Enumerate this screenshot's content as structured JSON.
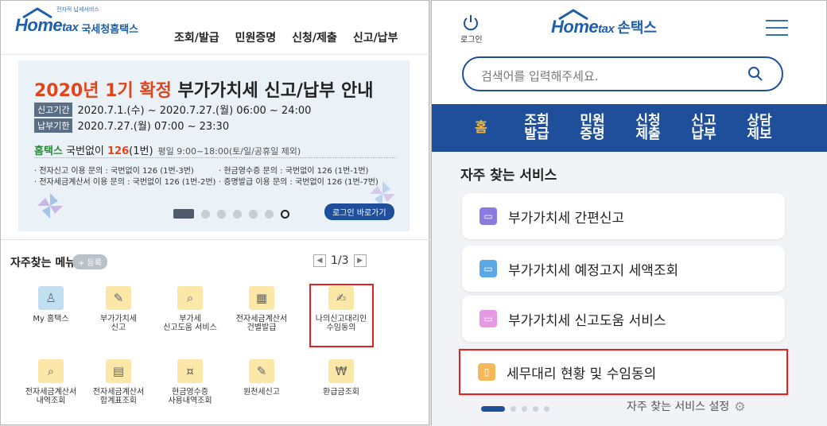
{
  "left": {
    "logo": {
      "small": "전자적 납세서비스",
      "brand_a": "Home",
      "brand_b": "tax",
      "kr": "국세청홈택스"
    },
    "nav": [
      "조회/발급",
      "민원증명",
      "신청/제출",
      "신고/납부"
    ],
    "banner": {
      "title_highlight": "2020년 1기 확정",
      "title_rest": "부가가치세 신고/납부 안내",
      "period_tag": "신고기간",
      "period_value": "2020.7.1.(수) ~ 2020.7.27.(월) 06:00 ~ 24:00",
      "pay_tag": "납부기한",
      "pay_value": "2020.7.27.(월) 07:00 ~ 23:30",
      "phone_brand": "홈택스",
      "phone_text": "국번없이",
      "phone_number": "126",
      "phone_suffix": "(1번)",
      "phone_hours": "평일 9:00~18:00(토/일/공휴일 제외)",
      "info_1a": "· 전자신고 이용 문의 : 국번없이 126 (1번-3번)",
      "info_1b": "· 현금영수증 문의 : 국번없이 126 (1번-1번)",
      "info_2a": "· 전자세금계산서 이용 문의 : 국번없이 126 (1번-2번)",
      "info_2b": "· 증명발급 이용 문의 : 국번없이 126 (1번-7번)",
      "login_button": "로그인 바로가기"
    },
    "favorites": {
      "title": "자주찾는 메뉴",
      "add_button": "+ 등록",
      "page": "1/3",
      "prev_glyph": "◀",
      "next_glyph": "▶",
      "items": [
        {
          "label": "My 홈택스",
          "icon": "person-icon",
          "glyph": "♙"
        },
        {
          "label": "부가가치세\n신고",
          "icon": "vat-report-icon",
          "glyph": "✎"
        },
        {
          "label": "부가세\n신고도움 서비스",
          "icon": "vat-help-icon",
          "glyph": "⌕"
        },
        {
          "label": "전자세금계산서\n건별발급",
          "icon": "calculator-icon",
          "glyph": "▦"
        },
        {
          "label": "나의신고대리인\n수임동의",
          "icon": "agent-consent-icon",
          "glyph": "✍"
        },
        {
          "label": "전자세금계산서\n내역조회",
          "icon": "invoice-search-icon",
          "glyph": "⌕"
        },
        {
          "label": "전자세금계산서\n합계표조회",
          "icon": "invoice-summary-icon",
          "glyph": "▤"
        },
        {
          "label": "현금영수증\n사용내역조회",
          "icon": "cash-receipt-icon",
          "glyph": "¤"
        },
        {
          "label": "원천세신고",
          "icon": "withholding-icon",
          "glyph": "✎"
        },
        {
          "label": "환급금조회",
          "icon": "refund-icon",
          "glyph": "₩"
        }
      ]
    }
  },
  "right": {
    "login_label": "로그인",
    "logo": {
      "brand_a": "Home",
      "brand_b": "tax",
      "kr": "손택스"
    },
    "search_placeholder": "검색어를 입력해주세요.",
    "nav": [
      {
        "label": "홈",
        "active": true
      },
      {
        "label": "조회\n발급",
        "active": false
      },
      {
        "label": "민원\n증명",
        "active": false
      },
      {
        "label": "신청\n제출",
        "active": false
      },
      {
        "label": "신고\n납부",
        "active": false
      },
      {
        "label": "상담\n제보",
        "active": false
      }
    ],
    "section_title": "자주 찾는 서비스",
    "services": [
      {
        "label": "부가가치세 간편신고",
        "color": "#8a7be0"
      },
      {
        "label": "부가가치세 예정고지 세액조회",
        "color": "#5aa9e6"
      },
      {
        "label": "부가가치세 신고도움 서비스",
        "color": "#e59ae3"
      },
      {
        "label": "세무대리 현황 및 수임동의",
        "color": "#f5b95a"
      }
    ],
    "settings_label": "자주 찾는 서비스 설정"
  },
  "colors": {
    "brand_blue": "#1f4f9a",
    "accent_orange": "#e0451b",
    "highlight_red": "#e42020"
  }
}
